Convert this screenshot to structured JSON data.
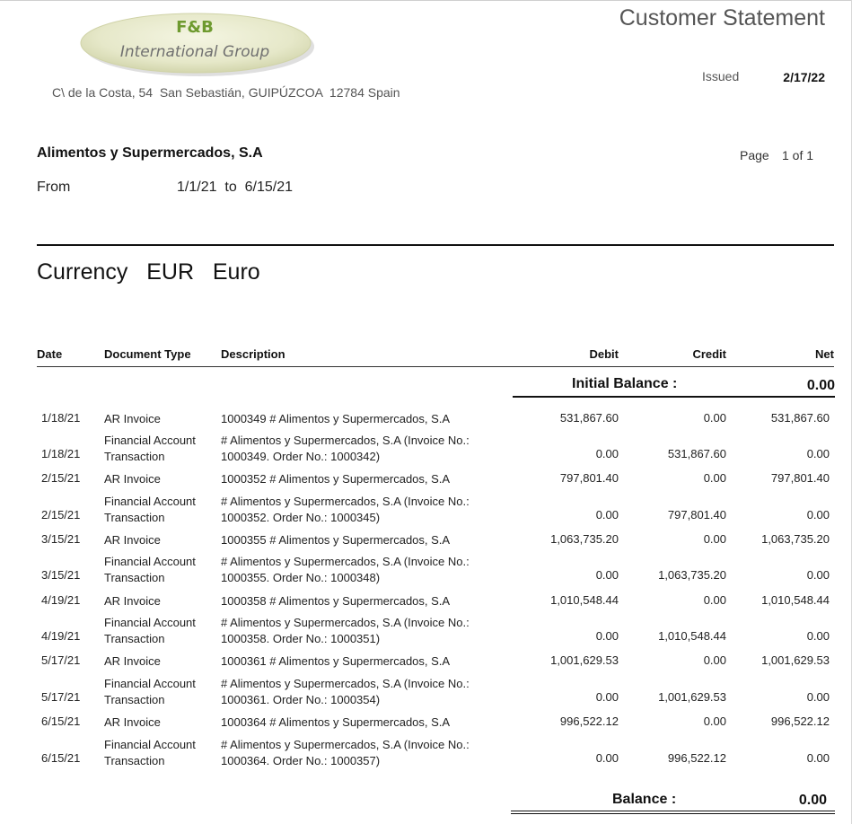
{
  "company": {
    "logo_line1": "F&B",
    "logo_line2": "International Group",
    "address": "C\\ de la Costa, 54  San Sebastián, GUIPÚZCOA  12784 Spain"
  },
  "header": {
    "title": "Customer Statement",
    "issued_label": "Issued",
    "issued_date": "2/17/22",
    "customer_name": "Alimentos y Supermercados, S.A",
    "page_label": "Page",
    "page_value": "1 of 1",
    "from_label": "From",
    "date_range": "1/1/21  to  6/15/21"
  },
  "currency": {
    "text": "Currency   EUR   Euro"
  },
  "table": {
    "columns": {
      "date": "Date",
      "document_type": "Document Type",
      "description": "Description",
      "debit": "Debit",
      "credit": "Credit",
      "net": "Net"
    },
    "initial_balance_label": "Initial Balance :",
    "initial_balance_value": "0.00",
    "rows": [
      {
        "date": "1/18/21",
        "doctype": "AR Invoice",
        "desc": "1000349 # Alimentos y Supermercados, S.A",
        "debit": "531,867.60",
        "credit": "0.00",
        "net": "531,867.60"
      },
      {
        "date": "1/18/21",
        "doctype": "Financial Account Transaction",
        "desc": "# Alimentos y Supermercados, S.A (Invoice No.: 1000349. Order No.: 1000342)",
        "debit": "0.00",
        "credit": "531,867.60",
        "net": "0.00"
      },
      {
        "date": "2/15/21",
        "doctype": "AR Invoice",
        "desc": "1000352 # Alimentos y Supermercados, S.A",
        "debit": "797,801.40",
        "credit": "0.00",
        "net": "797,801.40"
      },
      {
        "date": "2/15/21",
        "doctype": "Financial Account Transaction",
        "desc": "# Alimentos y Supermercados, S.A (Invoice No.: 1000352. Order No.: 1000345)",
        "debit": "0.00",
        "credit": "797,801.40",
        "net": "0.00"
      },
      {
        "date": "3/15/21",
        "doctype": "AR Invoice",
        "desc": "1000355 # Alimentos y Supermercados, S.A",
        "debit": "1,063,735.20",
        "credit": "0.00",
        "net": "1,063,735.20"
      },
      {
        "date": "3/15/21",
        "doctype": "Financial Account Transaction",
        "desc": "# Alimentos y Supermercados, S.A (Invoice No.: 1000355. Order No.: 1000348)",
        "debit": "0.00",
        "credit": "1,063,735.20",
        "net": "0.00"
      },
      {
        "date": "4/19/21",
        "doctype": "AR Invoice",
        "desc": "1000358 # Alimentos y Supermercados, S.A",
        "debit": "1,010,548.44",
        "credit": "0.00",
        "net": "1,010,548.44"
      },
      {
        "date": "4/19/21",
        "doctype": "Financial Account Transaction",
        "desc": "# Alimentos y Supermercados, S.A (Invoice No.: 1000358. Order No.: 1000351)",
        "debit": "0.00",
        "credit": "1,010,548.44",
        "net": "0.00"
      },
      {
        "date": "5/17/21",
        "doctype": "AR Invoice",
        "desc": "1000361 # Alimentos y Supermercados, S.A",
        "debit": "1,001,629.53",
        "credit": "0.00",
        "net": "1,001,629.53"
      },
      {
        "date": "5/17/21",
        "doctype": "Financial Account Transaction",
        "desc": "# Alimentos y Supermercados, S.A (Invoice No.: 1000361. Order No.: 1000354)",
        "debit": "0.00",
        "credit": "1,001,629.53",
        "net": "0.00"
      },
      {
        "date": "6/15/21",
        "doctype": "AR Invoice",
        "desc": "1000364 # Alimentos y Supermercados, S.A",
        "debit": "996,522.12",
        "credit": "0.00",
        "net": "996,522.12"
      },
      {
        "date": "6/15/21",
        "doctype": "Financial Account Transaction",
        "desc": "# Alimentos y Supermercados, S.A (Invoice No.: 1000364. Order No.: 1000357)",
        "debit": "0.00",
        "credit": "996,522.12",
        "net": "0.00"
      }
    ],
    "balance_label": "Balance :",
    "balance_value": "0.00"
  },
  "colors": {
    "logo_green": "#6e9a2f",
    "logo_gray": "#707070",
    "title_gray": "#555555"
  }
}
